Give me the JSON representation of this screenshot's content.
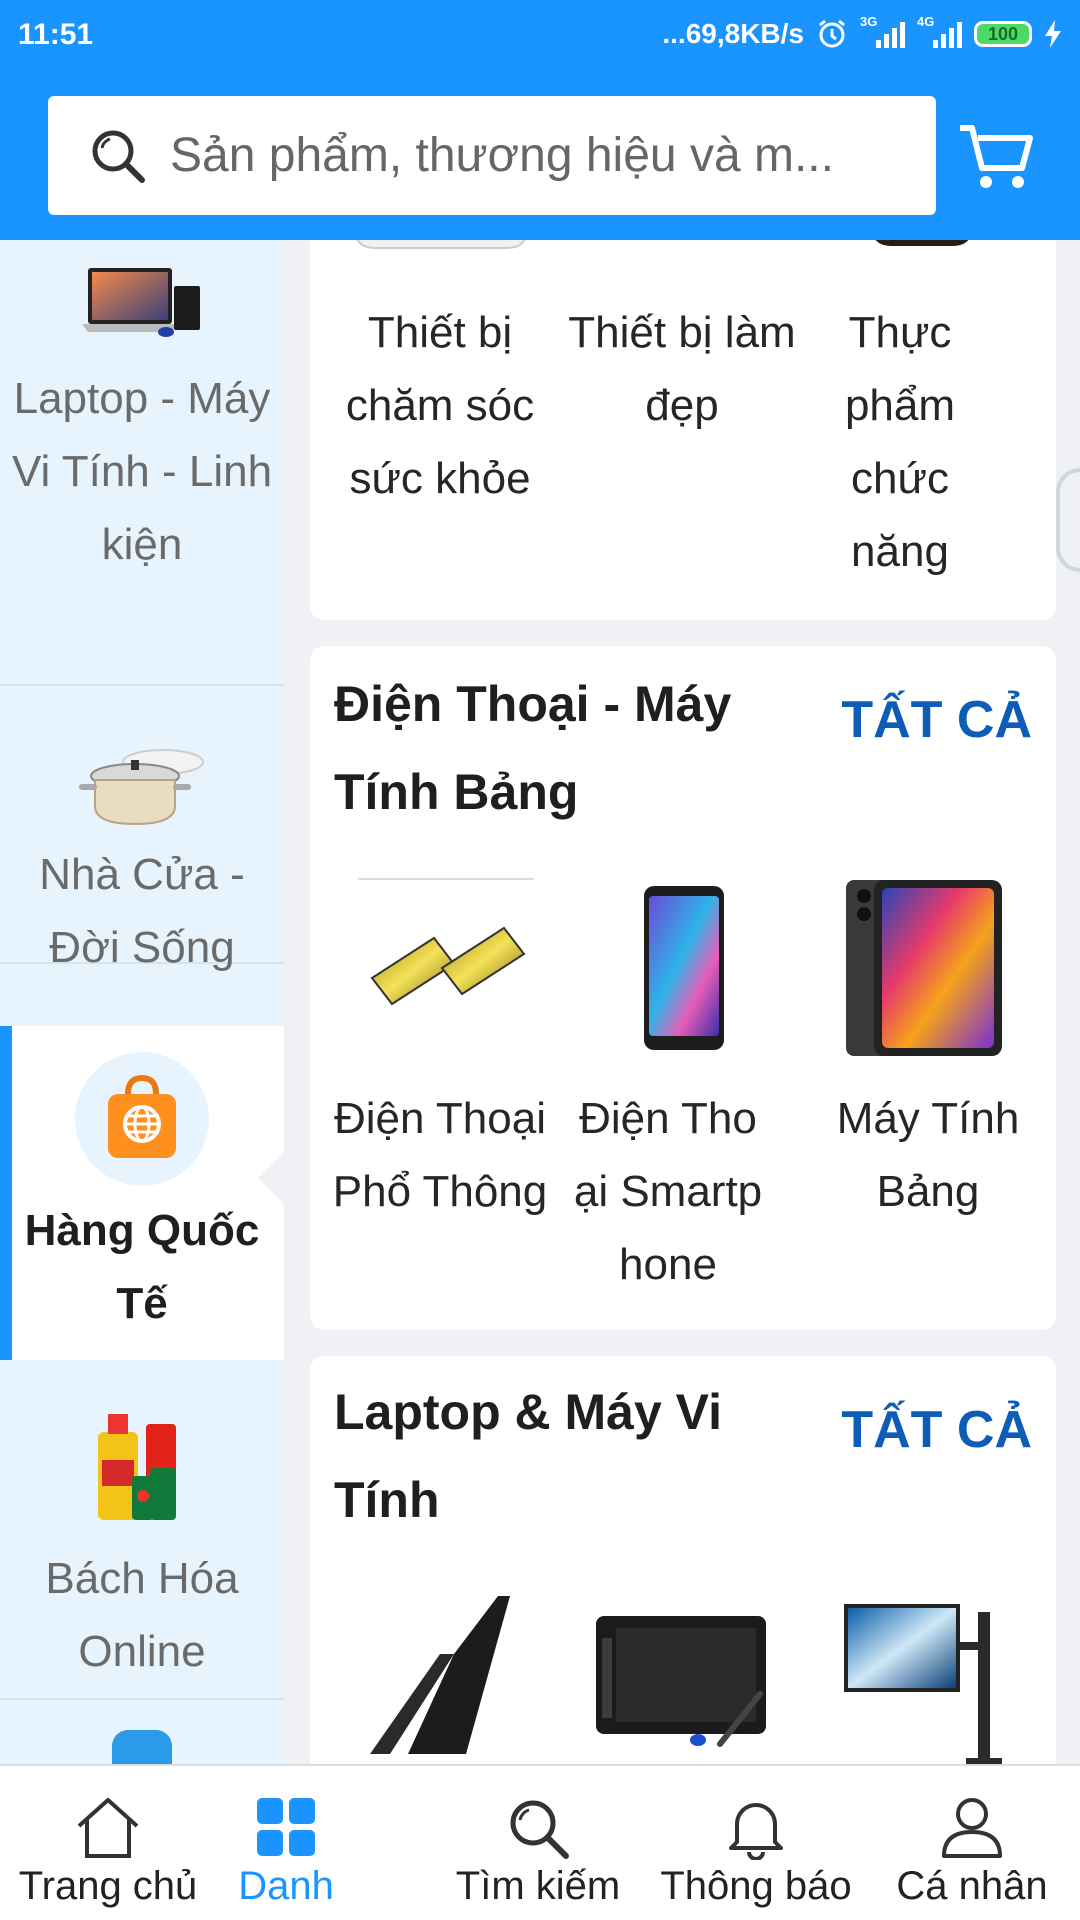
{
  "status_bar": {
    "time": "11:51",
    "net_speed": "...69,8KB/s",
    "net1": "3G",
    "net2": "4G",
    "battery": "100"
  },
  "search": {
    "placeholder": "Sản phẩm, thương hiệu và m..."
  },
  "sidebar": {
    "items": [
      {
        "label": "Laptop - Máy Vi Tính - Linh kiện",
        "icon": "laptop-image"
      },
      {
        "label": "Nhà Cửa - Đời Sống",
        "icon": "cookware-image"
      },
      {
        "label": "Hàng Quốc Tế",
        "icon": "global-shopping-bag-icon",
        "active": true
      },
      {
        "label": "Bách Hóa Online",
        "icon": "grocery-image"
      }
    ]
  },
  "top_card": {
    "items": [
      {
        "label": "Thiết bị chăm sóc sức khỏe"
      },
      {
        "label": "Thiết bị làm đẹp"
      },
      {
        "label": "Thực phẩm chức năng"
      }
    ]
  },
  "phones_card": {
    "title": "Điện Thoại - Máy Tính Bảng",
    "view_all": "TẤT CẢ",
    "items": [
      {
        "label": "Điện Thoại Phổ Thông"
      },
      {
        "label": "Điện Thoại Smartphone"
      },
      {
        "label": "Máy Tính Bảng"
      }
    ]
  },
  "laptop_card": {
    "title": "Laptop & Máy Vi Tính",
    "view_all": "TẤT CẢ"
  },
  "bottom_nav": {
    "tabs": [
      {
        "label": "Trang chủ",
        "icon": "home-icon"
      },
      {
        "label": "Danh",
        "icon": "category-grid-icon",
        "active": true
      },
      {
        "label": "Tìm kiếm",
        "icon": "search-icon"
      },
      {
        "label": "Thông báo",
        "icon": "bell-icon"
      },
      {
        "label": "Cá nhân",
        "icon": "user-icon"
      }
    ]
  },
  "colors": {
    "primary": "#1a94ff",
    "link": "#0d5cb6",
    "sidebar_bg": "#e8f4fd"
  }
}
